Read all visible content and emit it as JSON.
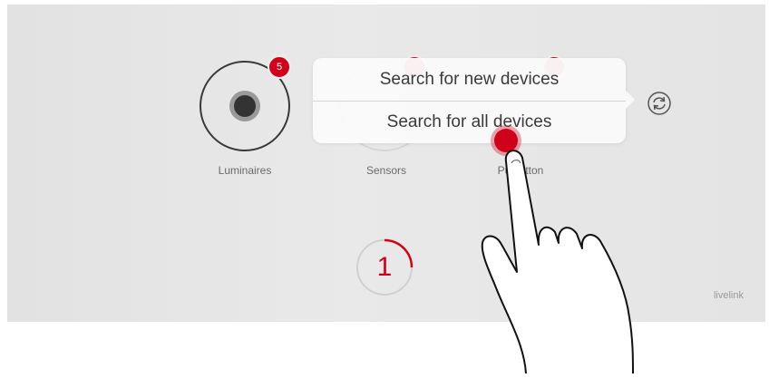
{
  "devices": [
    {
      "label": "Luminaires",
      "badge": "5"
    },
    {
      "label": "Sensors",
      "badge": ""
    },
    {
      "label": "Pushbutton",
      "visible_label": "Pus   tton",
      "badge": ""
    }
  ],
  "popover": {
    "item1": "Search for new devices",
    "item2": "Search for all devices"
  },
  "counter": {
    "value": "1",
    "progress": 0.25
  },
  "brand": "livelink",
  "icons": {
    "refresh": "refresh-icon",
    "hand": "pointing-hand-icon"
  },
  "colors": {
    "accent": "#d0021b",
    "background": "#e6e6e6"
  }
}
